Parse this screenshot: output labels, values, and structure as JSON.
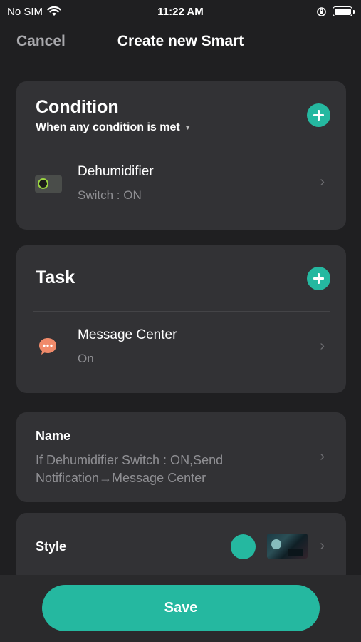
{
  "status_bar": {
    "carrier": "No SIM",
    "time": "11:22 AM"
  },
  "nav": {
    "cancel_label": "Cancel",
    "title": "Create new Smart"
  },
  "condition": {
    "title": "Condition",
    "mode": "When any condition is met",
    "items": [
      {
        "title": "Dehumidifier",
        "subtitle": "Switch : ON"
      }
    ]
  },
  "task": {
    "title": "Task",
    "items": [
      {
        "title": "Message Center",
        "subtitle": "On"
      }
    ]
  },
  "name": {
    "label": "Name",
    "value": "If Dehumidifier  Switch : ON,Send Notification→Message Center"
  },
  "style": {
    "label": "Style",
    "color": "#25b8a0"
  },
  "footer": {
    "save_label": "Save"
  },
  "theme": {
    "accent": "#25b8a0",
    "background": "#1f1f21",
    "card": "#323235"
  }
}
